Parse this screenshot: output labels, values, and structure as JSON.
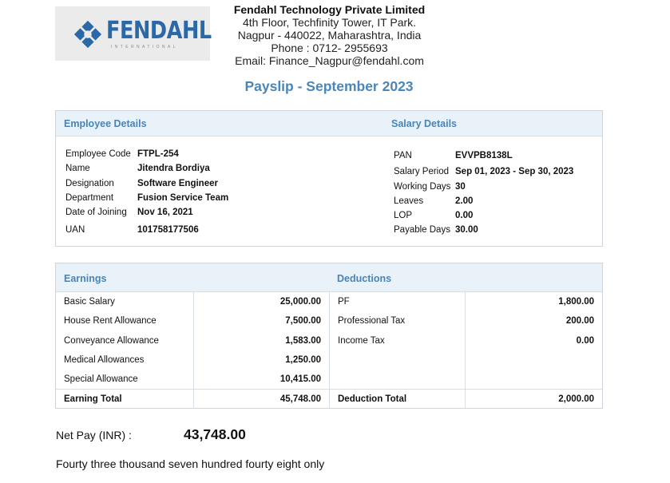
{
  "logo": {
    "name": "FENDAHL",
    "sub": "INTERNATIONAL",
    "brand_color": "#2b68a8"
  },
  "company": {
    "name": "Fendahl Technology Private Limited",
    "address1": "4th Floor, Techfinity Tower, IT Park.",
    "address2": "Nagpur - 440022, Maharashtra, India",
    "phone": "Phone : 0712- 2955693",
    "email": "Email: Finance_Nagpur@fendahl.com"
  },
  "title": "Payslip - September 2023",
  "employee": {
    "heading": "Employee Details",
    "code_label": "Employee Code",
    "code": "FTPL-254",
    "name_label": "Name",
    "name": "Jitendra Bordiya",
    "designation_label": "Designation",
    "designation": "Software Engineer",
    "department_label": "Department",
    "department": "Fusion Service Team",
    "doj_label": "Date of Joining",
    "doj": "Nov 16, 2021",
    "uan_label": "UAN",
    "uan": "101758177506"
  },
  "salary": {
    "heading": "Salary Details",
    "pan_label": "PAN",
    "pan": "EVVPB8138L",
    "period_label": "Salary Period",
    "period": "Sep 01, 2023 - Sep 30, 2023",
    "working_label": "Working Days",
    "working": "30",
    "leaves_label": "Leaves",
    "leaves": "2.00",
    "lop_label": "LOP",
    "lop": "0.00",
    "payable_label": "Payable Days",
    "payable": "30.00"
  },
  "earnings": {
    "heading": "Earnings",
    "rows": [
      {
        "label": "Basic Salary",
        "amount": "25,000.00"
      },
      {
        "label": "House Rent Allowance",
        "amount": "7,500.00"
      },
      {
        "label": "Conveyance Allowance",
        "amount": "1,583.00"
      },
      {
        "label": "Medical Allowances",
        "amount": "1,250.00"
      },
      {
        "label": "Special Allowance",
        "amount": "10,415.00"
      }
    ],
    "total_label": "Earning Total",
    "total": "45,748.00"
  },
  "deductions": {
    "heading": "Deductions",
    "rows": [
      {
        "label": "PF",
        "amount": "1,800.00"
      },
      {
        "label": "Professional Tax",
        "amount": "200.00"
      },
      {
        "label": "Income Tax",
        "amount": "0.00"
      }
    ],
    "total_label": "Deduction Total",
    "total": "2,000.00"
  },
  "netpay": {
    "label": "Net Pay (INR) :",
    "value": "43,748.00",
    "words": "Fourty three thousand seven hundred fourty eight only"
  }
}
